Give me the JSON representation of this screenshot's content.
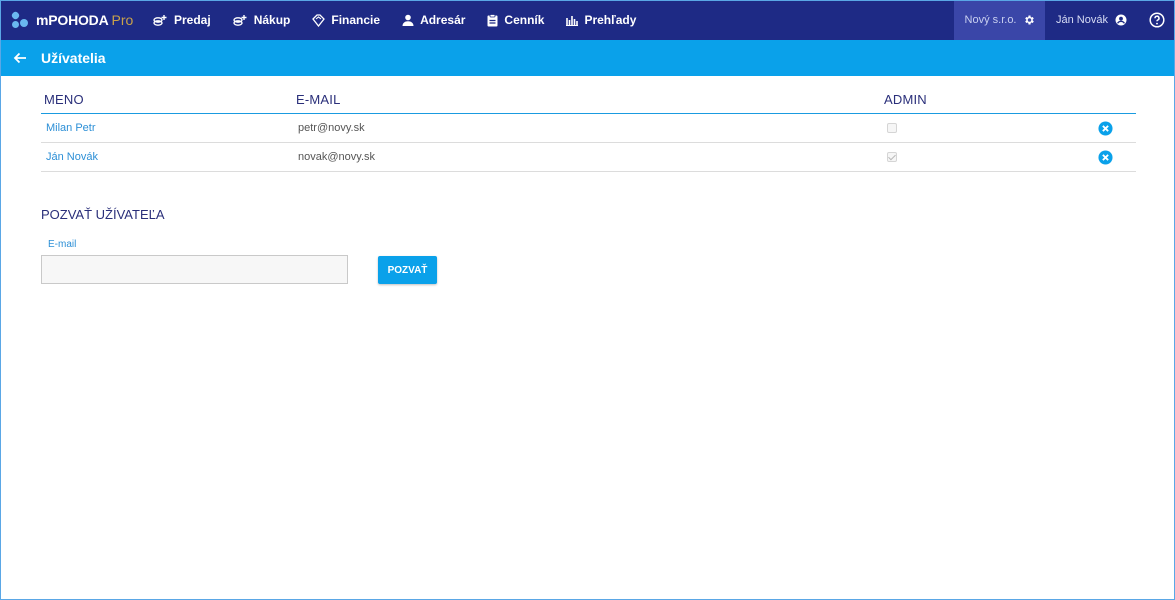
{
  "app": {
    "brand": "mPOHODA",
    "brand_suffix": "Pro"
  },
  "nav": {
    "items": [
      {
        "label": "Predaj",
        "icon": "sales-icon"
      },
      {
        "label": "Nákup",
        "icon": "purchase-icon"
      },
      {
        "label": "Financie",
        "icon": "finance-icon"
      },
      {
        "label": "Adresár",
        "icon": "person-icon"
      },
      {
        "label": "Cenník",
        "icon": "clipboard-icon"
      },
      {
        "label": "Prehľady",
        "icon": "bar-chart-icon"
      }
    ],
    "company": "Nový s.r.o.",
    "user": "Ján Novák"
  },
  "page": {
    "title": "Užívatelia"
  },
  "table": {
    "columns": [
      "MENO",
      "E-MAIL",
      "ADMIN"
    ],
    "rows": [
      {
        "name": "Milan Petr",
        "email": "petr@novy.sk",
        "admin": false
      },
      {
        "name": "Ján Novák",
        "email": "novak@novy.sk",
        "admin": true
      }
    ]
  },
  "invite": {
    "title": "POZVAŤ UŽÍVATEĽA",
    "email_label": "E-mail",
    "email_value": "",
    "button": "POZVAŤ"
  },
  "colors": {
    "topbar": "#1e2a85",
    "subbar": "#0aa1ea",
    "accent": "#2c8fd6"
  }
}
